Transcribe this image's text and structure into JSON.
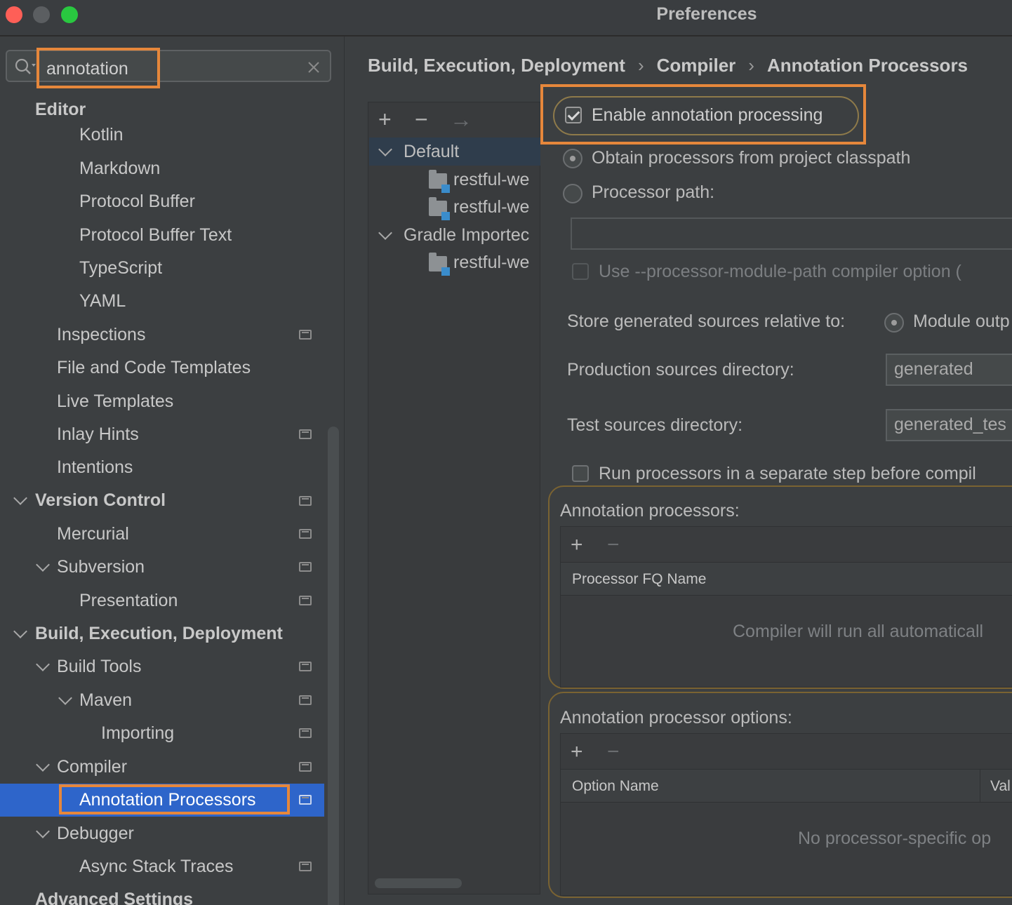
{
  "window": {
    "title": "Preferences",
    "controls": [
      "close",
      "minimize",
      "maximize"
    ],
    "colors": {
      "close": "#fe5f57",
      "minimize": "#5b5e61",
      "maximize": "#29c840"
    }
  },
  "search": {
    "value": "annotation",
    "clear_icon": "close-icon",
    "search_icon": "search-icon"
  },
  "sidebar": {
    "items": [
      {
        "label": "Editor"
      },
      {
        "label": "Kotlin"
      },
      {
        "label": "Markdown"
      },
      {
        "label": "Protocol Buffer"
      },
      {
        "label": "Protocol Buffer Text"
      },
      {
        "label": "TypeScript"
      },
      {
        "label": "YAML"
      },
      {
        "label": "Inspections"
      },
      {
        "label": "File and Code Templates"
      },
      {
        "label": "Live Templates"
      },
      {
        "label": "Inlay Hints"
      },
      {
        "label": "Intentions"
      },
      {
        "label": "Version Control"
      },
      {
        "label": "Mercurial"
      },
      {
        "label": "Subversion"
      },
      {
        "label": "Presentation"
      },
      {
        "label": "Build, Execution, Deployment"
      },
      {
        "label": "Build Tools"
      },
      {
        "label": "Maven"
      },
      {
        "label": "Importing"
      },
      {
        "label": "Compiler"
      },
      {
        "label": "Annotation Processors"
      },
      {
        "label": "Debugger"
      },
      {
        "label": "Async Stack Traces"
      },
      {
        "label": "Advanced Settings"
      }
    ],
    "selected": "Annotation Processors",
    "selection_color": "#2e65ca"
  },
  "breadcrumb": {
    "items": [
      "Build, Execution, Deployment",
      "Compiler",
      "Annotation Processors"
    ],
    "separator": "›"
  },
  "modules": {
    "toolbar": {
      "add": "+",
      "remove": "−",
      "move": "→"
    },
    "items": [
      {
        "label": "Default"
      },
      {
        "label": "restful-we"
      },
      {
        "label": "restful-we"
      },
      {
        "label": "Gradle Importec"
      },
      {
        "label": "restful-we"
      }
    ]
  },
  "settings": {
    "enable_processing": "Enable annotation processing",
    "obtain_from_classpath": "Obtain processors from project classpath",
    "processor_path": "Processor path:",
    "processor_path_value": "",
    "module_path_option": "Use --processor-module-path compiler option (",
    "store_generated": "Store generated sources relative to:",
    "module_output": "Module outp",
    "production_dir_label": "Production sources directory:",
    "production_dir_value": "generated",
    "test_dir_label": "Test sources directory:",
    "test_dir_value": "generated_tes",
    "run_separate_step": "Run processors in a separate step before compil"
  },
  "processors_table": {
    "title": "Annotation processors:",
    "add": "+",
    "remove": "−",
    "column": "Processor FQ Name",
    "empty": "Compiler will run all automaticall"
  },
  "options_table": {
    "title": "Annotation processor options:",
    "add": "+",
    "remove": "−",
    "column1": "Option Name",
    "column2": "Val",
    "empty": "No processor-specific op"
  },
  "highlight_color": "#e6873b"
}
